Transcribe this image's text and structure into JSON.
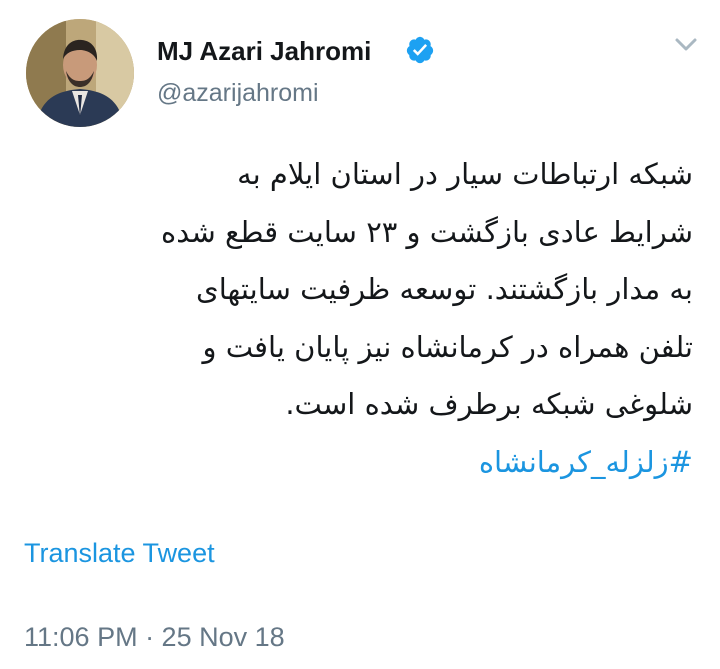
{
  "tweet": {
    "author": {
      "display_name": "MJ Azari Jahromi",
      "handle": "@azarijahromi",
      "verified": true
    },
    "text_lines": [
      "شبکه ارتباطات سیار در استان ایلام به",
      "شرایط عادی بازگشت و ۲۳ سایت قطع شده",
      "به مدار بازگشتند. توسعه ظرفیت سایتهای",
      "تلفن همراه در کرمانشاه نیز پایان یافت و",
      "شلوغی شبکه برطرف شده است."
    ],
    "hashtag": "#زلزله_کرمانشاه",
    "translate_label": "Translate Tweet",
    "timestamp": "11:06 PM · 25 Nov 18"
  },
  "icons": {
    "verified": "verified-badge-icon",
    "caret": "chevron-down-icon"
  },
  "colors": {
    "link_blue": "#1b95e0",
    "secondary_gray": "#657786",
    "text_dark": "#14171a"
  }
}
